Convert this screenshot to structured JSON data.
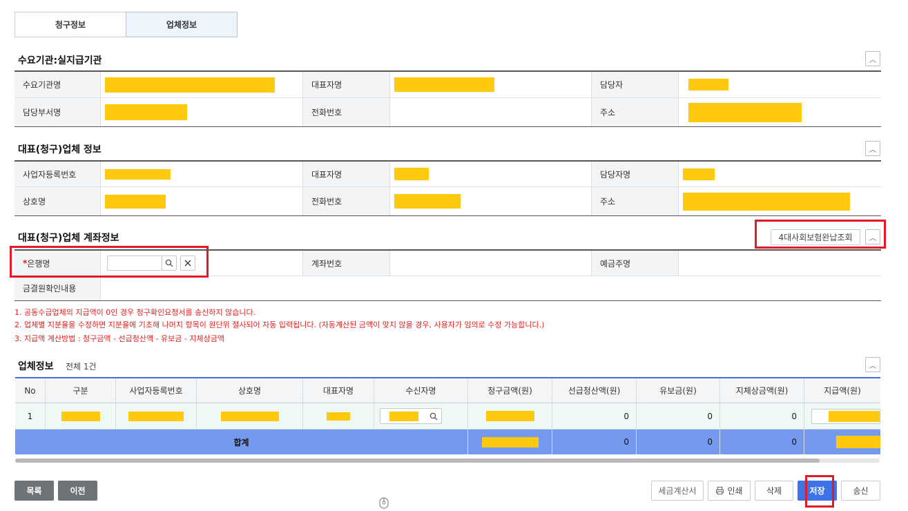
{
  "tabs": [
    {
      "label": "청구정보"
    },
    {
      "label": "업체정보"
    }
  ],
  "sections": {
    "demand": {
      "title": "수요기관:실지급기관",
      "labels": {
        "org_name": "수요기관명",
        "rep_name": "대표자명",
        "manager": "담당자",
        "dept_name": "담당부서명",
        "phone": "전화번호",
        "address": "주소"
      }
    },
    "vendor": {
      "title": "대표(청구)업체 정보",
      "labels": {
        "biz_no": "사업자등록번호",
        "rep_name": "대표자명",
        "manager": "담당자명",
        "company": "상호명",
        "phone": "전화번호",
        "address": "주소"
      }
    },
    "account": {
      "title": "대표(청구)업체 계좌정보",
      "insurance_button": "4대사회보험완납조회",
      "labels": {
        "required_mark": "*",
        "bank": "은행명",
        "account_no": "계좌번호",
        "holder": "예금주명",
        "confirm": "금결원확인내용"
      }
    }
  },
  "notices": [
    "1. 공동수급업체의 지급액이 0인 경우 청구확인요청서를 송신하지 않습니다.",
    "2. 업체별 지분율을 수정하면 지분율에 기초해 나머지 항목이 원단위 절사되어 자동 입력됩니다. (자동계산된 금액이 맞지 않을 경우, 사용자가 임의로 수정 가능합니다.)",
    "3. 지급액 계산방법 : 청구금액 - 선급청산액 - 유보금 - 지체상금액"
  ],
  "grid": {
    "title": "업체정보",
    "total": "전체 1건",
    "columns": [
      "No",
      "구분",
      "사업자등록번호",
      "상호명",
      "대표자명",
      "수신자명",
      "청구금액(원)",
      "선급청산액(원)",
      "유보금(원)",
      "지체상금액(원)",
      "지급액(원)"
    ],
    "rows": [
      {
        "no": "1",
        "advance": "0",
        "retention": "0",
        "penalty": "0"
      }
    ],
    "sum": {
      "label": "합계",
      "advance": "0",
      "retention": "0",
      "penalty": "0"
    }
  },
  "buttons": {
    "list": "목록",
    "prev": "이전",
    "tax_invoice": "세금계산서",
    "print": "인쇄",
    "delete": "삭제",
    "save": "저장",
    "send": "송신"
  },
  "colors": {
    "primary": "#3d73e6",
    "sum_row": "#7699f0",
    "highlight": "#e01b24",
    "redaction": "#ffc90e",
    "notice": "#e02020"
  }
}
